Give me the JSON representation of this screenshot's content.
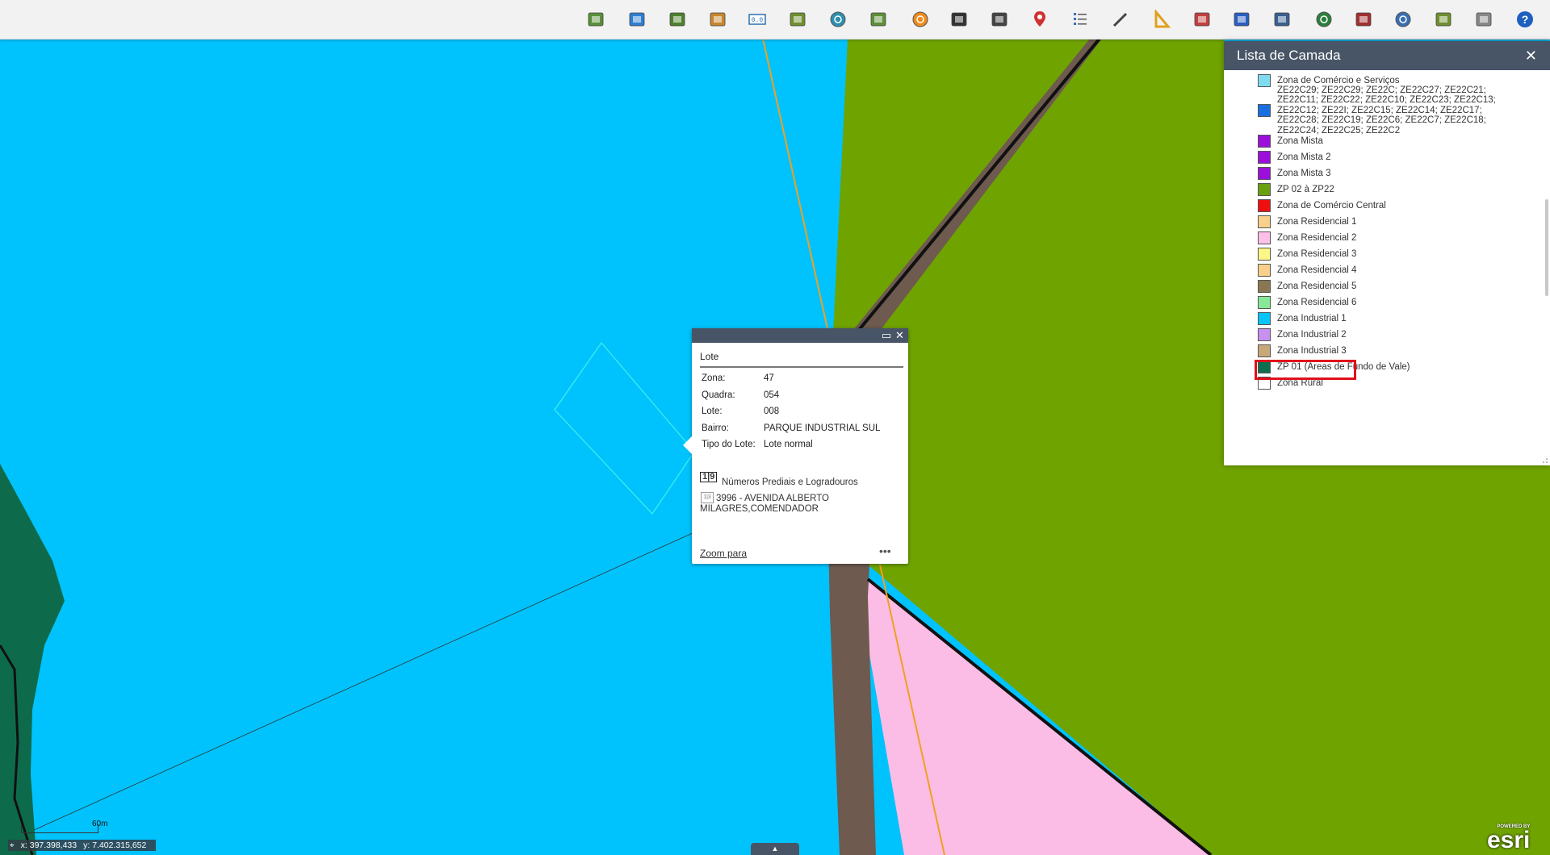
{
  "toolbar": {
    "tools": [
      {
        "icon": "map-add-icon",
        "color": "#5a8f3a"
      },
      {
        "icon": "zoom-search-icon",
        "color": "#2f7fd0"
      },
      {
        "icon": "layers-icon",
        "color": "#4e7f2e"
      },
      {
        "icon": "map-tools-icon",
        "color": "#c8862e"
      },
      {
        "icon": "coordinate-icon",
        "color": "#2f6fb0"
      },
      {
        "icon": "notebook-icon",
        "color": "#6f8f30"
      },
      {
        "icon": "globe-search-icon",
        "color": "#2e8fb0"
      },
      {
        "icon": "parcels-icon",
        "color": "#5d8f3a"
      },
      {
        "icon": "orange-circle-icon",
        "color": "#f08a1c"
      },
      {
        "icon": "binoculars-icon",
        "color": "#333333"
      },
      {
        "icon": "binoculars-dark-icon",
        "color": "#444444"
      },
      {
        "icon": "location-pin-icon",
        "color": "#d03030"
      },
      {
        "icon": "list-icon",
        "color": "#3a6fb0"
      },
      {
        "icon": "pencil-icon",
        "color": "#444444"
      },
      {
        "icon": "ruler-triangle-icon",
        "color": "#e0a020"
      },
      {
        "icon": "users-icon",
        "color": "#c04040"
      },
      {
        "icon": "car-icon",
        "color": "#2a5fc0"
      },
      {
        "icon": "printer-icon",
        "color": "#3a5f90"
      },
      {
        "icon": "globe-icon",
        "color": "#2a7f3a"
      },
      {
        "icon": "book-icon",
        "color": "#a03030"
      },
      {
        "icon": "world-settings-icon",
        "color": "#3a6fb0"
      },
      {
        "icon": "zoom-box-icon",
        "color": "#6f8f30"
      },
      {
        "icon": "dwg-export-icon",
        "color": "#888888"
      },
      {
        "icon": "help-icon",
        "color": "#1f5fc0"
      }
    ]
  },
  "legend": {
    "title": "Lista de Camada",
    "close_label": "✕",
    "items": [
      {
        "label": "Zona de Comércio e Serviços",
        "color": "#7fdcf0"
      },
      {
        "label": "ZE22C29; ZE22C29; ZE22C; ZE22C27; ZE22C21; ZE22C11; ZE22C22; ZE22C10; ZE22C23; ZE22C13; ZE22C12; ZE22I; ZE22C15; ZE22C14; ZE22C17; ZE22C28; ZE22C19; ZE22C6; ZE22C7; ZE22C18; ZE22C24; ZE22C25; ZE22C2",
        "color": "#1a6fe0"
      },
      {
        "label": "Zona Mista",
        "color": "#9b10d8"
      },
      {
        "label": "Zona Mista 2",
        "color": "#9b10d8"
      },
      {
        "label": "Zona Mista 3",
        "color": "#9b10d8"
      },
      {
        "label": "ZP 02 à ZP22",
        "color": "#6aa010"
      },
      {
        "label": "Zona de Comércio Central",
        "color": "#ee1010"
      },
      {
        "label": "Zona Residencial 1",
        "color": "#f8d08a"
      },
      {
        "label": "Zona Residencial 2",
        "color": "#fcc0e8"
      },
      {
        "label": "Zona Residencial 3",
        "color": "#fcf688"
      },
      {
        "label": "Zona Residencial 4",
        "color": "#f8d08a"
      },
      {
        "label": "Zona Residencial 5",
        "color": "#8a7650"
      },
      {
        "label": "Zona Residencial 6",
        "color": "#88e898"
      },
      {
        "label": "Zona Industrial 1",
        "color": "#08c4f8"
      },
      {
        "label": "Zona Industrial 2",
        "color": "#c890f0"
      },
      {
        "label": "Zona Industrial 3",
        "color": "#c8a878"
      },
      {
        "label": "ZP 01 (Áreas de Fundo de Vale)",
        "color": "#0e6e50"
      },
      {
        "label": "Zona Rural",
        "color": "#ffffff"
      }
    ]
  },
  "popup": {
    "title": "Lote",
    "attributes": [
      {
        "key": "Zona:",
        "value": "47"
      },
      {
        "key": "Quadra:",
        "value": "054"
      },
      {
        "key": "Lote:",
        "value": "008"
      },
      {
        "key": "Bairro:",
        "value": "PARQUE INDUSTRIAL SUL"
      },
      {
        "key": "Tipo do Lote:",
        "value": "Lote normal"
      }
    ],
    "related_icon_text": "1|9",
    "related_title": "Números Prediais e Logradouros",
    "address_icon_text": "1|3",
    "address": "3996 - AVENIDA ALBERTO MILAGRES,COMENDADOR",
    "zoom_label": "Zoom para",
    "more_label": "•••"
  },
  "map": {
    "colors": {
      "industrial": "#00c3fd",
      "green": "#6fa300",
      "pink": "#fbbde6",
      "dark_green": "#0d6b4b",
      "road": "#6e5a4e",
      "orange_line": "#f0a020",
      "parcel_outline": "#3cf0f0"
    },
    "scale_label": "60m",
    "coord_x": "x: 397.398,433",
    "coord_y": "y: 7.402.315,652",
    "toggle_label": "▲",
    "logo_powered": "POWERED BY",
    "logo_word": "esri"
  }
}
